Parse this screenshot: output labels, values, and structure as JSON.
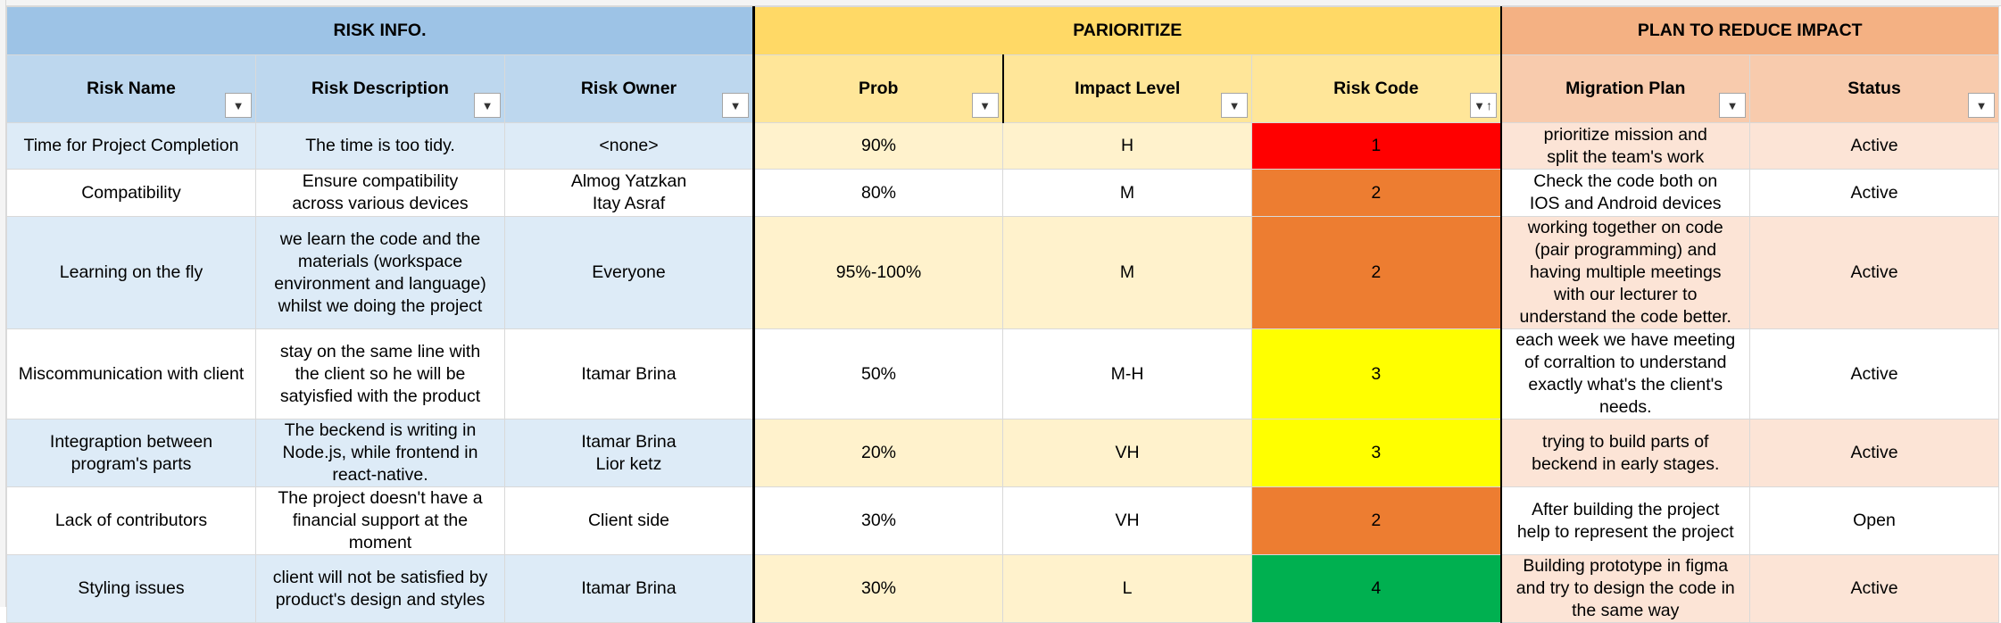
{
  "sections": {
    "info": "RISK INFO.",
    "prioritize": "PARIORITIZE",
    "plan": "PLAN TO REDUCE IMPACT"
  },
  "headers": {
    "risk_name": "Risk Name",
    "risk_description": "Risk Description",
    "risk_owner": "Risk Owner",
    "prob": "Prob",
    "impact_level": "Impact Level",
    "risk_code": "Risk Code",
    "migration_plan": "Migration Plan",
    "status": "Status"
  },
  "filter_icon": "▼",
  "sort_icon": "↑",
  "rows": [
    {
      "name": "Time for Project Completion",
      "description": "The time is too tidy.",
      "owner": "<none>",
      "prob": "90%",
      "impact": "H",
      "code": "1",
      "plan": "prioritize mission and\nsplit the team's work",
      "status": "Active"
    },
    {
      "name": "Compatibility",
      "description": "Ensure compatibility\nacross various devices",
      "owner": "Almog Yatzkan\nItay Asraf",
      "prob": "80%",
      "impact": "M",
      "code": "2",
      "plan": "Check the code both on\nIOS and Android devices",
      "status": "Active"
    },
    {
      "name": "Learning on the fly",
      "description": "we learn the code and the\nmaterials (workspace\nenvironment and language)\nwhilst we doing the project",
      "owner": "Everyone",
      "prob": "95%-100%",
      "impact": "M",
      "code": "2",
      "plan": "working together on code\n(pair programming) and\nhaving multiple meetings\nwith our lecturer to\nunderstand the code better.",
      "status": "Active"
    },
    {
      "name": "Miscommunication with client",
      "description": "stay on the same line with\nthe client so he will be\nsatyisfied with the product",
      "owner": "Itamar Brina",
      "prob": "50%",
      "impact": "M-H",
      "code": "3",
      "plan": "each week we have meeting\nof corraltion to understand\nexactly what's the client's\nneeds.",
      "status": "Active"
    },
    {
      "name": "Integraption between\nprogram's parts",
      "description": "The beckend is writing in\nNode.js, while frontend in\nreact-native.",
      "owner": "Itamar Brina\nLior ketz",
      "prob": "20%",
      "impact": "VH",
      "code": "3",
      "plan": "trying to build parts of\nbeckend in early stages.",
      "status": "Active"
    },
    {
      "name": "Lack of contributors",
      "description": "The project doesn't have a\nfinancial support at the\nmoment",
      "owner": "Client side",
      "prob": "30%",
      "impact": "VH",
      "code": "2",
      "plan": "After building the project\nhelp to represent the project",
      "status": "Open"
    },
    {
      "name": "Styling issues",
      "description": "client will not be satisfied by\nproduct's design and styles",
      "owner": "Itamar Brina",
      "prob": "30%",
      "impact": "L",
      "code": "4",
      "plan": "Building prototype in figma\nand try to design the code in\nthe same way",
      "status": "Active"
    }
  ],
  "colors": {
    "code_1": "#ff0000",
    "code_2": "#ed7d31",
    "code_3": "#ffff00",
    "code_4": "#00b050"
  }
}
